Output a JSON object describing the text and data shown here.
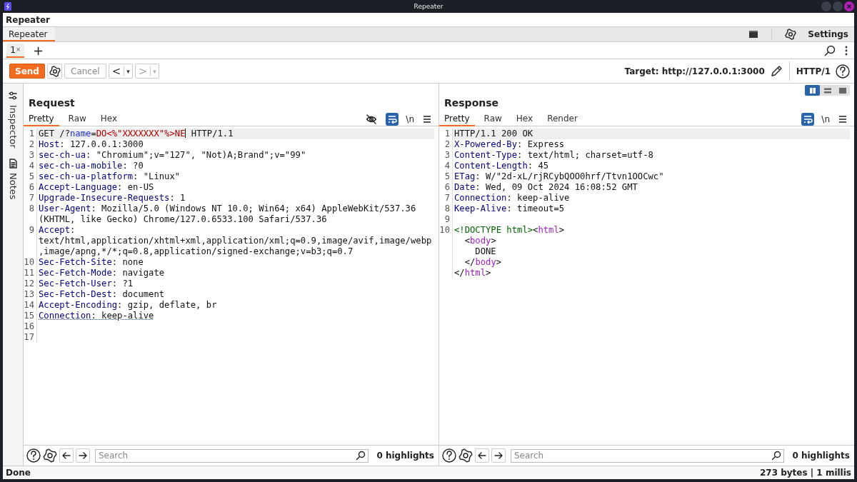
{
  "window": {
    "title": "Repeater"
  },
  "header": {
    "title": "Repeater"
  },
  "tool_tabs": [
    {
      "label": "Repeater",
      "selected": true
    }
  ],
  "settings": {
    "label": "Settings"
  },
  "request_tabs": [
    {
      "label": "1",
      "close": "×",
      "selected": true
    }
  ],
  "add_tab": "+",
  "toolbar": {
    "send": "Send",
    "cancel": {
      "label": "Cancel",
      "disabled": true
    },
    "back": {
      "label": "<",
      "menu": "▾",
      "disabled": false
    },
    "forward": {
      "label": ">",
      "menu": "▾",
      "disabled": true
    },
    "target": "Target: http://127.0.0.1:3000",
    "protocol": "HTTP/1"
  },
  "layout_modes": [
    {
      "kind": "columns",
      "selected": true
    },
    {
      "kind": "rows",
      "selected": false
    },
    {
      "kind": "single",
      "selected": false
    }
  ],
  "side_tabs": [
    {
      "kind": "inspector",
      "label": "Inspector"
    },
    {
      "kind": "notes",
      "label": "Notes"
    }
  ],
  "request": {
    "title": "Request",
    "hide_toggle": true,
    "wrap_on": true,
    "newline_label": "\\n",
    "tabs": [
      {
        "label": "Pretty",
        "selected": true
      },
      {
        "label": "Raw",
        "selected": false
      },
      {
        "label": "Hex",
        "selected": false
      }
    ],
    "lines": [
      {
        "n": "1",
        "current": true,
        "segs": [
          {
            "kind": "plain",
            "text": "GET /?"
          },
          {
            "kind": "param",
            "text": "name"
          },
          {
            "kind": "plain",
            "text": "="
          },
          {
            "kind": "value",
            "text": "DO<%\"XXXXXXX\"%>NE",
            "caret": true
          },
          {
            "kind": "plain",
            "text": " HTTP/1.1"
          }
        ]
      },
      {
        "n": "2",
        "current": false,
        "segs": [
          {
            "kind": "key",
            "text": "Host"
          },
          {
            "kind": "plain",
            "text": ": 127.0.0.1:3000"
          }
        ]
      },
      {
        "n": "3",
        "current": false,
        "segs": [
          {
            "kind": "key",
            "text": "sec-ch-ua"
          },
          {
            "kind": "plain",
            "text": ": \"Chromium\";v=\"127\", \"Not)A;Brand\";v=\"99\""
          }
        ]
      },
      {
        "n": "4",
        "current": false,
        "segs": [
          {
            "kind": "key",
            "text": "sec-ch-ua-mobile"
          },
          {
            "kind": "plain",
            "text": ": ?0"
          }
        ]
      },
      {
        "n": "5",
        "current": false,
        "segs": [
          {
            "kind": "key",
            "text": "sec-ch-ua-platform"
          },
          {
            "kind": "plain",
            "text": ": \"Linux\""
          }
        ]
      },
      {
        "n": "6",
        "current": false,
        "segs": [
          {
            "kind": "key",
            "text": "Accept-Language"
          },
          {
            "kind": "plain",
            "text": ": en-US"
          }
        ]
      },
      {
        "n": "7",
        "current": false,
        "segs": [
          {
            "kind": "key",
            "text": "Upgrade-Insecure-Requests"
          },
          {
            "kind": "plain",
            "text": ": 1"
          }
        ]
      },
      {
        "n": "8",
        "current": false,
        "segs": [
          {
            "kind": "key",
            "text": "User-Agent"
          },
          {
            "kind": "plain",
            "text": ": Mozilla/5.0 (Windows NT 10.0; Win64; x64) AppleWebKit/537.36 (KHTML, like Gecko) Chrome/127.0.6533.100 Safari/537.36"
          }
        ]
      },
      {
        "n": "9",
        "current": false,
        "segs": [
          {
            "kind": "key",
            "text": "Accept"
          },
          {
            "kind": "plain",
            "text": ": text/html,application/xhtml+xml,application/xml;q=0.9,image/avif,image/webp,image/apng,*/*;q=0.8,application/signed-exchange;v=b3;q=0.7"
          }
        ]
      },
      {
        "n": "10",
        "current": false,
        "segs": [
          {
            "kind": "key",
            "text": "Sec-Fetch-Site"
          },
          {
            "kind": "plain",
            "text": ": none"
          }
        ]
      },
      {
        "n": "11",
        "current": false,
        "segs": [
          {
            "kind": "key",
            "text": "Sec-Fetch-Mode"
          },
          {
            "kind": "plain",
            "text": ": navigate"
          }
        ]
      },
      {
        "n": "12",
        "current": false,
        "segs": [
          {
            "kind": "key",
            "text": "Sec-Fetch-User"
          },
          {
            "kind": "plain",
            "text": ": ?1"
          }
        ]
      },
      {
        "n": "13",
        "current": false,
        "segs": [
          {
            "kind": "key",
            "text": "Sec-Fetch-Dest"
          },
          {
            "kind": "plain",
            "text": ": document"
          }
        ]
      },
      {
        "n": "14",
        "current": false,
        "segs": [
          {
            "kind": "key",
            "text": "Accept-Encoding"
          },
          {
            "kind": "plain",
            "text": ": gzip, deflate, br"
          }
        ]
      },
      {
        "n": "15",
        "current": false,
        "dotted_underline": true,
        "segs": [
          {
            "kind": "key",
            "text": "Connection"
          },
          {
            "kind": "plain",
            "text": ": keep-alive"
          }
        ]
      },
      {
        "n": "16",
        "current": false
      },
      {
        "n": "17",
        "current": false
      }
    ],
    "search": {
      "placeholder": "Search"
    },
    "highlights": "0 highlights"
  },
  "response": {
    "title": "Response",
    "hide_toggle": false,
    "wrap_on": true,
    "newline_label": "\\n",
    "tabs": [
      {
        "label": "Pretty",
        "selected": true
      },
      {
        "label": "Raw",
        "selected": false
      },
      {
        "label": "Hex",
        "selected": false
      },
      {
        "label": "Render",
        "selected": false
      }
    ],
    "lines": [
      {
        "n": "1",
        "current": true,
        "segs": [
          {
            "kind": "plain",
            "text": "HTTP/1.1 200 OK"
          }
        ]
      },
      {
        "n": "2",
        "current": false,
        "segs": [
          {
            "kind": "key",
            "text": "X-Powered-By"
          },
          {
            "kind": "plain",
            "text": ": Express"
          }
        ]
      },
      {
        "n": "3",
        "current": false,
        "segs": [
          {
            "kind": "key",
            "text": "Content-Type"
          },
          {
            "kind": "plain",
            "text": ": text/html; charset=utf-8"
          }
        ]
      },
      {
        "n": "4",
        "current": false,
        "segs": [
          {
            "kind": "key",
            "text": "Content-Length"
          },
          {
            "kind": "plain",
            "text": ": 45"
          }
        ]
      },
      {
        "n": "5",
        "current": false,
        "segs": [
          {
            "kind": "key",
            "text": "ETag"
          },
          {
            "kind": "plain",
            "text": ": W/\"2d-xL/rjRCybQOO0hrf/Ttvn1OOCwc\""
          }
        ]
      },
      {
        "n": "6",
        "current": false,
        "segs": [
          {
            "kind": "key",
            "text": "Date"
          },
          {
            "kind": "plain",
            "text": ": Wed, 09 Oct 2024 16:08:52 GMT"
          }
        ]
      },
      {
        "n": "7",
        "current": false,
        "segs": [
          {
            "kind": "key",
            "text": "Connection"
          },
          {
            "kind": "plain",
            "text": ": keep-alive"
          }
        ]
      },
      {
        "n": "8",
        "current": false,
        "segs": [
          {
            "kind": "key",
            "text": "Keep-Alive"
          },
          {
            "kind": "plain",
            "text": ": timeout=5"
          }
        ]
      },
      {
        "n": "9",
        "current": false
      },
      {
        "n": "10",
        "current": false,
        "segs": [
          {
            "kind": "doctype",
            "text": "<!DOCTYPE html>"
          },
          {
            "kind": "plain",
            "text": "<"
          },
          {
            "kind": "tag",
            "text": "html"
          },
          {
            "kind": "plain",
            "text": ">\n  <"
          },
          {
            "kind": "tag",
            "text": "body"
          },
          {
            "kind": "plain",
            "text": ">\n    DONE\n  </"
          },
          {
            "kind": "tag",
            "text": "body"
          },
          {
            "kind": "plain",
            "text": ">\n</"
          },
          {
            "kind": "tag",
            "text": "html"
          },
          {
            "kind": "plain",
            "text": ">"
          }
        ]
      }
    ],
    "search": {
      "placeholder": "Search"
    },
    "highlights": "0 highlights"
  },
  "status_bar": {
    "left": "Done",
    "right": "273 bytes | 1 millis"
  }
}
